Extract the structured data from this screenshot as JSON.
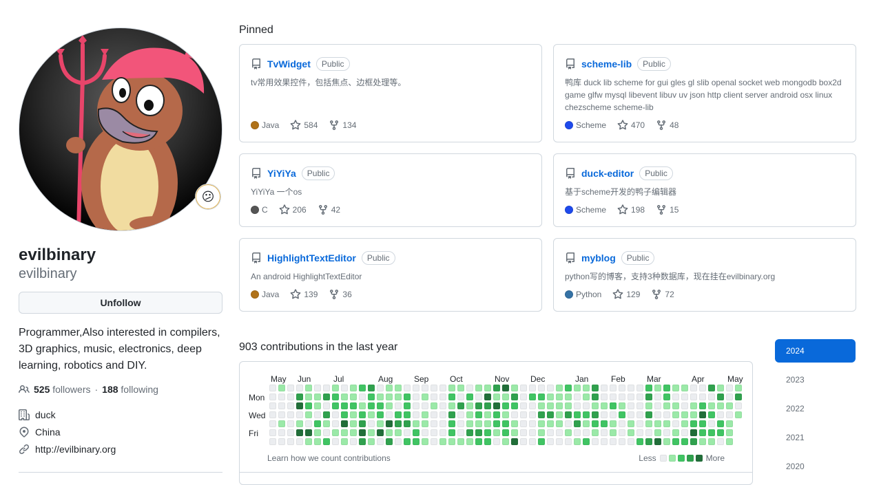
{
  "profile": {
    "name": "evilbinary",
    "login": "evilbinary",
    "status_emoji": "😕",
    "follow_button": "Unfollow",
    "bio": "Programmer,Also interested in compilers, 3D graphics, music, electronics, deep learning, robotics and DIY.",
    "followers_count": "525",
    "followers_label": "followers",
    "separator": "·",
    "following_count": "188",
    "following_label": "following",
    "organization": "duck",
    "location": "China",
    "website": "http://evilbinary.org"
  },
  "pinned": {
    "title": "Pinned",
    "repos": [
      {
        "name": "TvWidget",
        "visibility": "Public",
        "description": "tv常用效果控件，包括焦点、边框处理等。",
        "language": "Java",
        "language_color": "#b07219",
        "stars": "584",
        "forks": "134"
      },
      {
        "name": "scheme-lib",
        "visibility": "Public",
        "description": "鸭库 duck lib scheme for gui gles gl slib openal socket web mongodb box2d game glfw mysql libevent libuv uv json http client server android osx linux chezscheme scheme-lib",
        "language": "Scheme",
        "language_color": "#1e4aec",
        "stars": "470",
        "forks": "48"
      },
      {
        "name": "YiYiYa",
        "visibility": "Public",
        "description": "YiYiYa 一个os",
        "language": "C",
        "language_color": "#555555",
        "stars": "206",
        "forks": "42"
      },
      {
        "name": "duck-editor",
        "visibility": "Public",
        "description": "基于scheme开发的鸭子编辑器",
        "language": "Scheme",
        "language_color": "#1e4aec",
        "stars": "198",
        "forks": "15"
      },
      {
        "name": "HighlightTextEditor",
        "visibility": "Public",
        "description": "An android HighlightTextEditor",
        "language": "Java",
        "language_color": "#b07219",
        "stars": "139",
        "forks": "36"
      },
      {
        "name": "myblog",
        "visibility": "Public",
        "description": "python写的博客，支持3种数据库，现在挂在evilbinary.org",
        "language": "Python",
        "language_color": "#3572A5",
        "stars": "129",
        "forks": "72"
      }
    ]
  },
  "contributions": {
    "title": "903 contributions in the last year",
    "months": [
      "May",
      "Jun",
      "Jul",
      "Aug",
      "Sep",
      "Oct",
      "Nov",
      "Dec",
      "Jan",
      "Feb",
      "Mar",
      "Apr",
      "May"
    ],
    "month_week_index": [
      0,
      3,
      7,
      12,
      16,
      20,
      25,
      29,
      34,
      38,
      42,
      47,
      51
    ],
    "day_labels": [
      "Mon",
      "Wed",
      "Fri"
    ],
    "level_colors": [
      "#ebedf0",
      "#9be9a8",
      "#40c463",
      "#30a14e",
      "#216e39"
    ],
    "learn_link": "Learn how we count contributions",
    "legend_less": "Less",
    "legend_more": "More"
  },
  "years": [
    "2024",
    "2023",
    "2022",
    "2021",
    "2020"
  ],
  "selected_year": "2024"
}
